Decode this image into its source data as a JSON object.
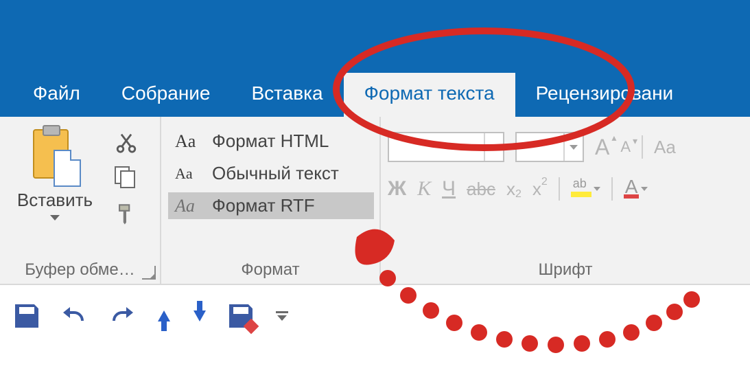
{
  "tabs": {
    "file": "Файл",
    "meeting": "Собрание",
    "insert": "Вставка",
    "format_text": "Формат текста",
    "review": "Рецензировани"
  },
  "clipboard": {
    "paste": "Вставить",
    "group_label": "Буфер обме…"
  },
  "format": {
    "html": "Формат HTML",
    "plain": "Обычный текст",
    "rtf": "Формат RTF",
    "group_label": "Формат"
  },
  "font": {
    "group_label": "Шрифт",
    "bold": "Ж",
    "italic": "К",
    "underline": "Ч",
    "strike": "abc",
    "sub_base": "x",
    "sub_s": "2",
    "sup_base": "x",
    "sup_s": "2",
    "fontcolor_letter": "A",
    "styles_aa": "Aa"
  }
}
